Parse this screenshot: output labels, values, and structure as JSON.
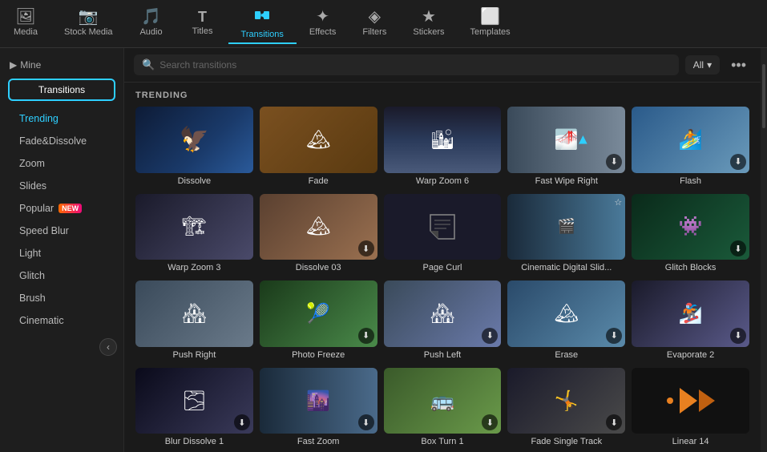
{
  "nav": {
    "items": [
      {
        "id": "media",
        "label": "Media",
        "icon": "🖼"
      },
      {
        "id": "stock",
        "label": "Stock Media",
        "icon": "📷"
      },
      {
        "id": "audio",
        "label": "Audio",
        "icon": "🎵"
      },
      {
        "id": "titles",
        "label": "Titles",
        "icon": "T"
      },
      {
        "id": "transitions",
        "label": "Transitions",
        "icon": "⇄"
      },
      {
        "id": "effects",
        "label": "Effects",
        "icon": "✦"
      },
      {
        "id": "filters",
        "label": "Filters",
        "icon": "◈"
      },
      {
        "id": "stickers",
        "label": "Stickers",
        "icon": "★"
      },
      {
        "id": "templates",
        "label": "Templates",
        "icon": "⬜"
      }
    ],
    "active": "transitions"
  },
  "sidebar": {
    "mine_label": "Mine",
    "transitions_btn": "Transitions",
    "items": [
      {
        "id": "trending",
        "label": "Trending",
        "active": true
      },
      {
        "id": "fade",
        "label": "Fade&Dissolve"
      },
      {
        "id": "zoom",
        "label": "Zoom"
      },
      {
        "id": "slides",
        "label": "Slides"
      },
      {
        "id": "popular",
        "label": "Popular",
        "badge": "NEW"
      },
      {
        "id": "speedblur",
        "label": "Speed Blur"
      },
      {
        "id": "light",
        "label": "Light"
      },
      {
        "id": "glitch",
        "label": "Glitch"
      },
      {
        "id": "brush",
        "label": "Brush"
      },
      {
        "id": "cinematic",
        "label": "Cinematic"
      }
    ],
    "collapse_icon": "‹"
  },
  "search": {
    "placeholder": "Search transitions",
    "filter_label": "All",
    "filter_icon": "▾",
    "more_icon": "•••"
  },
  "section": {
    "label": "TRENDING"
  },
  "grid": {
    "items": [
      {
        "id": "dissolve",
        "label": "Dissolve",
        "theme": "dissolve",
        "has_cursor": false,
        "has_download": false,
        "has_fav": false
      },
      {
        "id": "fade",
        "label": "Fade",
        "theme": "fade",
        "has_cursor": false,
        "has_download": false,
        "has_fav": false
      },
      {
        "id": "warpzoom6",
        "label": "Warp Zoom 6",
        "theme": "warpzoom6",
        "has_cursor": false,
        "has_download": false,
        "has_fav": false
      },
      {
        "id": "fastwipe",
        "label": "Fast Wipe Right",
        "theme": "fastwipe",
        "has_cursor": true,
        "has_download": true,
        "has_fav": false
      },
      {
        "id": "flash",
        "label": "Flash",
        "theme": "flash",
        "has_cursor": false,
        "has_download": true,
        "has_fav": false
      },
      {
        "id": "warpzoom3",
        "label": "Warp Zoom 3",
        "theme": "warpzoom3",
        "has_cursor": false,
        "has_download": false,
        "has_fav": false
      },
      {
        "id": "dissolve03",
        "label": "Dissolve 03",
        "theme": "dissolve03",
        "has_cursor": false,
        "has_download": true,
        "has_fav": false
      },
      {
        "id": "pagecurl",
        "label": "Page Curl",
        "theme": "pagecurl",
        "has_cursor": false,
        "has_download": false,
        "has_fav": false
      },
      {
        "id": "cinematic",
        "label": "Cinematic Digital Slid...",
        "theme": "cinematic",
        "has_cursor": false,
        "has_download": false,
        "has_fav": true
      },
      {
        "id": "glitch",
        "label": "Glitch Blocks",
        "theme": "glitch",
        "has_cursor": false,
        "has_download": true,
        "has_fav": false
      },
      {
        "id": "pushright",
        "label": "Push Right",
        "theme": "pushright",
        "has_cursor": false,
        "has_download": false,
        "has_fav": false
      },
      {
        "id": "photofreeze",
        "label": "Photo Freeze",
        "theme": "photofreeze",
        "has_cursor": false,
        "has_download": true,
        "has_fav": false
      },
      {
        "id": "pushleft",
        "label": "Push Left",
        "theme": "pushleft",
        "has_cursor": false,
        "has_download": true,
        "has_fav": false
      },
      {
        "id": "erase",
        "label": "Erase",
        "theme": "erase",
        "has_cursor": false,
        "has_download": true,
        "has_fav": false
      },
      {
        "id": "evaporate",
        "label": "Evaporate 2",
        "theme": "evaporate",
        "has_cursor": false,
        "has_download": true,
        "has_fav": false
      },
      {
        "id": "blurdissolve",
        "label": "Blur Dissolve 1",
        "theme": "blurdissolve",
        "has_cursor": false,
        "has_download": true,
        "has_fav": false
      },
      {
        "id": "fastzoom",
        "label": "Fast Zoom",
        "theme": "fastzoom",
        "has_cursor": false,
        "has_download": true,
        "has_fav": false
      },
      {
        "id": "boxturn",
        "label": "Box Turn 1",
        "theme": "boxturn",
        "has_cursor": false,
        "has_download": true,
        "has_fav": false
      },
      {
        "id": "fadesingle",
        "label": "Fade Single Track",
        "theme": "fadesingle",
        "has_cursor": false,
        "has_download": true,
        "has_fav": false
      },
      {
        "id": "linear14",
        "label": "Linear 14",
        "theme": "linear14",
        "has_cursor": false,
        "has_download": false,
        "has_fav": false
      }
    ]
  }
}
